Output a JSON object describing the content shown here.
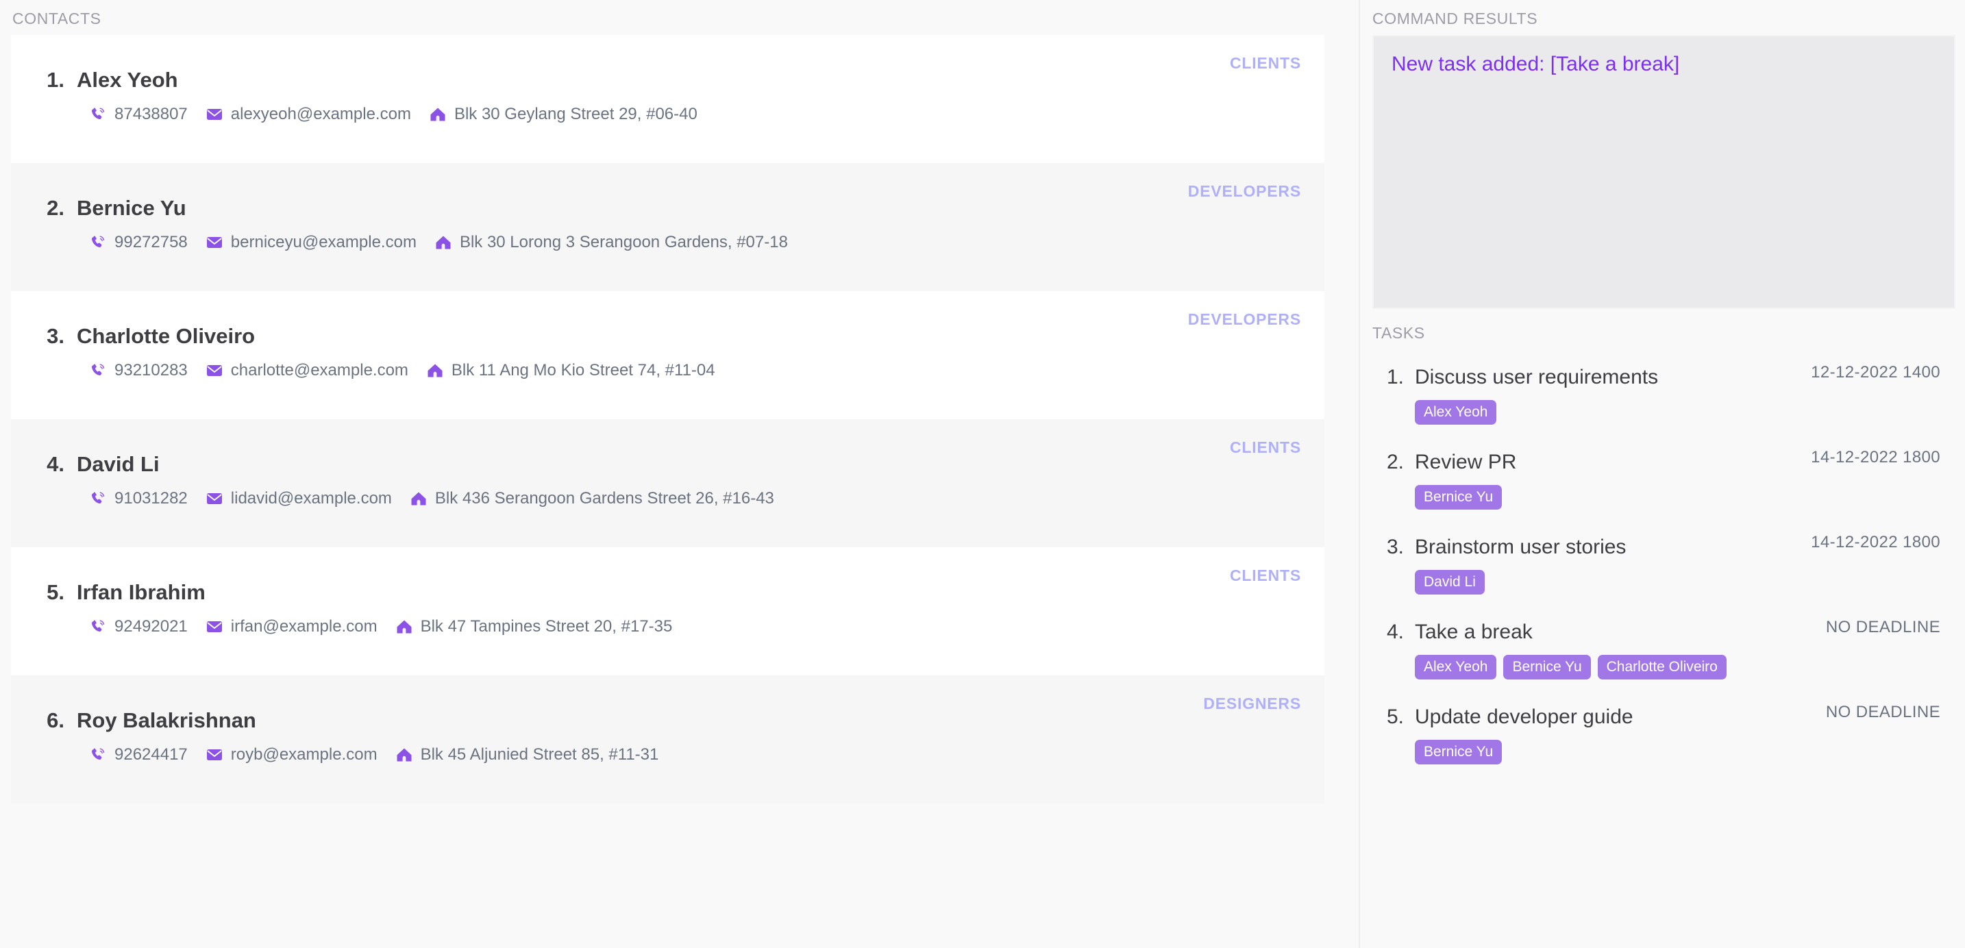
{
  "contacts_panel": {
    "header": "CONTACTS",
    "contacts": [
      {
        "index": "1.",
        "name": "Alex Yeoh",
        "tag": "CLIENTS",
        "phone": "87438807",
        "email": "alexyeoh@example.com",
        "address": "Blk 30 Geylang Street 29, #06-40"
      },
      {
        "index": "2.",
        "name": "Bernice Yu",
        "tag": "DEVELOPERS",
        "phone": "99272758",
        "email": "berniceyu@example.com",
        "address": "Blk 30 Lorong 3 Serangoon Gardens, #07-18"
      },
      {
        "index": "3.",
        "name": "Charlotte Oliveiro",
        "tag": "DEVELOPERS",
        "phone": "93210283",
        "email": "charlotte@example.com",
        "address": "Blk 11 Ang Mo Kio Street 74, #11-04"
      },
      {
        "index": "4.",
        "name": "David Li",
        "tag": "CLIENTS",
        "phone": "91031282",
        "email": "lidavid@example.com",
        "address": "Blk 436 Serangoon Gardens Street 26, #16-43"
      },
      {
        "index": "5.",
        "name": "Irfan Ibrahim",
        "tag": "CLIENTS",
        "phone": "92492021",
        "email": "irfan@example.com",
        "address": "Blk 47 Tampines Street 20, #17-35"
      },
      {
        "index": "6.",
        "name": "Roy Balakrishnan",
        "tag": "DESIGNERS",
        "phone": "92624417",
        "email": "royb@example.com",
        "address": "Blk 45 Aljunied Street 85, #11-31"
      }
    ],
    "icons": {
      "phone": "phone-icon",
      "email": "email-icon",
      "address": "home-icon"
    }
  },
  "command_results": {
    "header": "COMMAND RESULTS",
    "lines": [
      "New task added: [Take a break]"
    ]
  },
  "tasks_panel": {
    "header": "TASKS",
    "tasks": [
      {
        "index": "1.",
        "title": "Discuss user requirements",
        "deadline": "12-12-2022 1400",
        "people": [
          "Alex Yeoh"
        ]
      },
      {
        "index": "2.",
        "title": "Review PR",
        "deadline": "14-12-2022 1800",
        "people": [
          "Bernice Yu"
        ]
      },
      {
        "index": "3.",
        "title": "Brainstorm user stories",
        "deadline": "14-12-2022 1800",
        "people": [
          "David Li"
        ]
      },
      {
        "index": "4.",
        "title": "Take a break",
        "deadline": "NO DEADLINE",
        "people": [
          "Alex Yeoh",
          "Bernice Yu",
          "Charlotte Oliveiro"
        ]
      },
      {
        "index": "5.",
        "title": "Update developer guide",
        "deadline": "NO DEADLINE",
        "people": [
          "Bernice Yu"
        ]
      }
    ]
  },
  "colors": {
    "page_background": "#f9f9fa",
    "card_background": "#ffffff",
    "card_background_alt": "#f6f6f7",
    "contact_tag_text": "#b0b0f8",
    "person_tag_background": "#a177e8",
    "person_tag_text": "#ffffff",
    "result_text": "#7b2ff2",
    "icon_purple": "#8c52e5",
    "detail_text": "#6b7280",
    "heading_text": "#3d3d42",
    "section_label": "#9c9ca6",
    "results_box_background": "#eaeaec"
  }
}
